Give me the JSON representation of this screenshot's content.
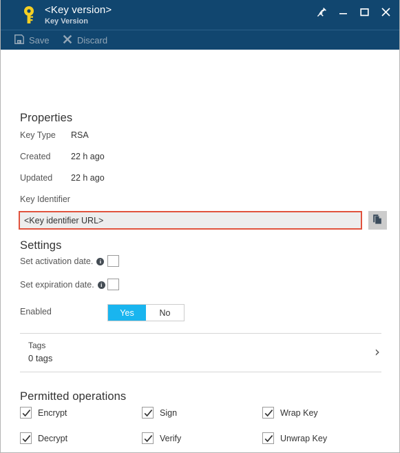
{
  "window": {
    "title": "<Key version>",
    "subtitle": "Key Version",
    "icon": "key-icon",
    "controls": [
      {
        "name": "pin-icon",
        "label": "Pin"
      },
      {
        "name": "minimize-icon",
        "label": "Minimize"
      },
      {
        "name": "maximize-icon",
        "label": "Maximize"
      },
      {
        "name": "close-icon",
        "label": "Close"
      }
    ],
    "titlebar_color": "#11466f"
  },
  "toolbar": {
    "save_label": "Save",
    "discard_label": "Discard",
    "save_icon": "save-disk-icon",
    "discard_icon": "cross-icon",
    "disabled_color": "#93a6b6"
  },
  "properties": {
    "heading": "Properties",
    "rows": [
      {
        "label": "Key Type",
        "value": "RSA"
      },
      {
        "label": "Created",
        "value": "22 h ago"
      },
      {
        "label": "Updated",
        "value": "22 h ago"
      },
      {
        "label": "Key Identifier",
        "value": ""
      }
    ],
    "key_identifier": {
      "value": "<Key identifier URL>",
      "copy_icon": "copy-pages-icon",
      "highlight_color": "#e1523d",
      "field_background": "#ededed"
    }
  },
  "settings": {
    "heading": "Settings",
    "activation": {
      "label": "Set activation date.",
      "info_icon": "info-icon",
      "checked": false
    },
    "expiration": {
      "label": "Set expiration date.",
      "info_icon": "info-icon",
      "checked": false
    },
    "enabled": {
      "label": "Enabled",
      "yes_label": "Yes",
      "no_label": "No",
      "selected": "Yes",
      "accent_color": "#19b5ef"
    }
  },
  "tags": {
    "title": "Tags",
    "count_label": "0 tags",
    "chevron_icon": "chevron-right-icon"
  },
  "permitted_operations": {
    "heading": "Permitted operations",
    "items": [
      {
        "label": "Encrypt",
        "checked": true
      },
      {
        "label": "Sign",
        "checked": true
      },
      {
        "label": "Wrap Key",
        "checked": true
      },
      {
        "label": "Decrypt",
        "checked": true
      },
      {
        "label": "Verify",
        "checked": true
      },
      {
        "label": "Unwrap Key",
        "checked": true
      }
    ]
  }
}
